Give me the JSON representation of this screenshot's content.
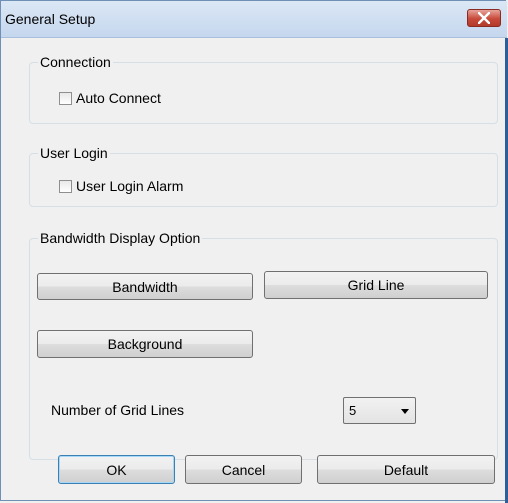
{
  "window": {
    "title": "General Setup"
  },
  "connection": {
    "group_label": "Connection",
    "auto_connect_label": "Auto Connect"
  },
  "user_login": {
    "group_label": "User Login",
    "alarm_label": "User Login Alarm"
  },
  "bandwidth": {
    "group_label": "Bandwidth Display Option",
    "bandwidth_button": "Bandwidth",
    "grid_line_button": "Grid Line",
    "background_button": "Background",
    "grid_lines_label": "Number of Grid Lines",
    "grid_lines_value": "5"
  },
  "footer": {
    "ok": "OK",
    "cancel": "Cancel",
    "default": "Default"
  },
  "colors": {
    "close_button": "#c74a3a",
    "titlebar": "#c5d7ee",
    "frame": "#2f5f99"
  }
}
